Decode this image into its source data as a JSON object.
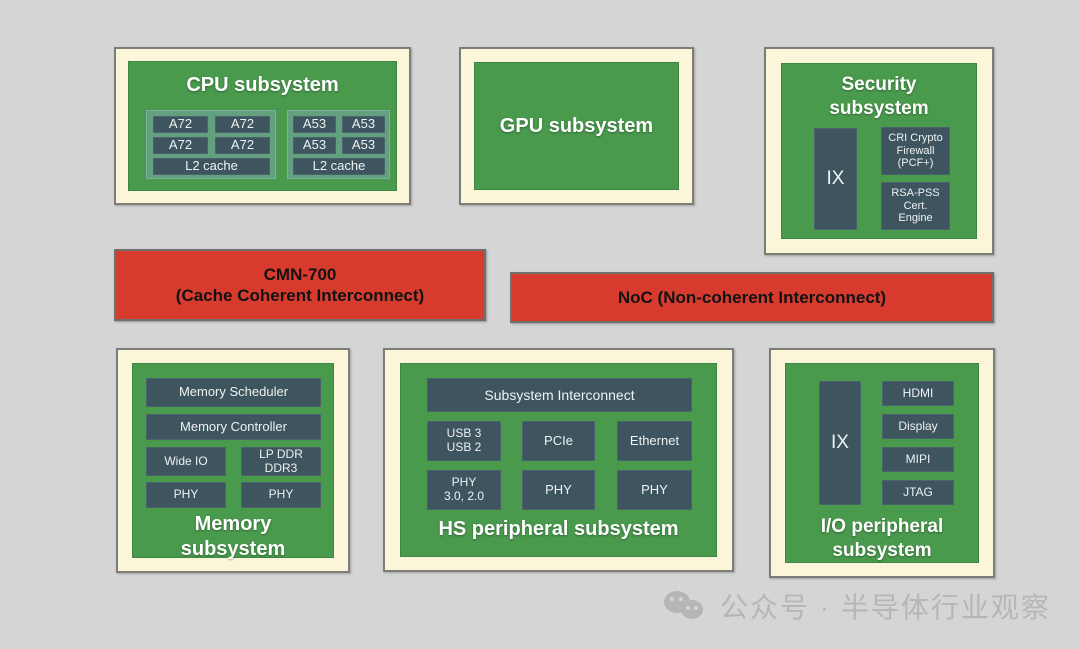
{
  "diagram": {
    "background_color": "#d5d5d5",
    "frame_color": "#fbf6d9",
    "green_color": "#4a9a4e",
    "block_color": "#3e555f",
    "interconnect_color": "#d73b2e"
  },
  "cpu": {
    "title": "CPU subsystem",
    "cluster_a": [
      "A72",
      "A72",
      "A72",
      "A72"
    ],
    "cluster_a_cache": "L2 cache",
    "cluster_b": [
      "A53",
      "A53",
      "A53",
      "A53"
    ],
    "cluster_b_cache": "L2 cache"
  },
  "gpu": {
    "title": "GPU subsystem"
  },
  "security": {
    "title_line1": "Security",
    "title_line2": "subsystem",
    "ix": "IX",
    "blocks": [
      "CRI Crypto\nFirewall\n(PCF+)",
      "RSA-PSS\nCert.\nEngine"
    ]
  },
  "interconnects": [
    {
      "name": "cmn-700",
      "line1": "CMN-700",
      "line2": "(Cache Coherent Interconnect)"
    },
    {
      "name": "noc",
      "line1": "NoC (Non-coherent Interconnect)",
      "line2": ""
    }
  ],
  "memory": {
    "title_line1": "Memory",
    "title_line2": "subsystem",
    "scheduler": "Memory Scheduler",
    "controller": "Memory Controller",
    "wide_io": "Wide IO",
    "lpddr": "LP DDR\nDDR3",
    "phy_left": "PHY",
    "phy_right": "PHY"
  },
  "hs_peripheral": {
    "title": "HS peripheral subsystem",
    "interconnect": "Subsystem Interconnect",
    "row1": [
      "USB 3\nUSB 2",
      "PCIe",
      "Ethernet"
    ],
    "row2": [
      "PHY\n3.0, 2.0",
      "PHY",
      "PHY"
    ]
  },
  "io_peripheral": {
    "title_line1": "I/O peripheral",
    "title_line2": "subsystem",
    "ix": "IX",
    "blocks": [
      "HDMI",
      "Display",
      "MIPI",
      "JTAG"
    ]
  },
  "watermark": {
    "text": "公众号 · 半导体行业观察",
    "icon": "wechat-icon"
  }
}
